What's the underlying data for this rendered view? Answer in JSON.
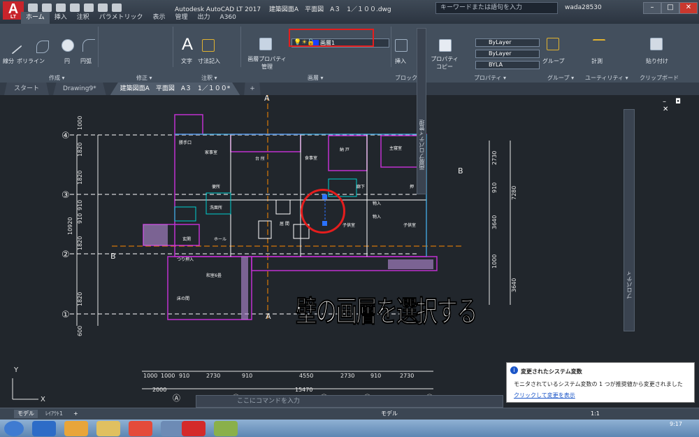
{
  "app": {
    "logo": "A",
    "logo_sub": "LT",
    "title": "Autodesk AutoCAD LT 2017　 建築図面A　平面図　A３　1／１００.dwg",
    "search_placeholder": "キーワードまたは語句を入力",
    "user": "wada28530"
  },
  "ribbon_tabs": [
    "ホーム",
    "挿入",
    "注釈",
    "パラメトリック",
    "表示",
    "管理",
    "出力",
    "A360"
  ],
  "ribbon": {
    "draw_buttons": [
      "線分",
      "ポリライン",
      "円",
      "円弧"
    ],
    "text": "文字",
    "dim": "寸法記入",
    "layer_props": "画層プロパティ管理",
    "layer_current": "画層1",
    "insert": "挿入",
    "props_copy": "プロパティコピー",
    "bylayer1": "ByLayer",
    "bylayer2": "ByLayer",
    "bylayer3": "BYLA",
    "group": "グループ",
    "measure": "計測",
    "paste": "貼り付け",
    "panels": [
      "作成 ▾",
      "修正 ▾",
      "注釈 ▾",
      "画層 ▾",
      "ブロック",
      "プロパティ ▾",
      "グループ ▾",
      "ユーティリティ ▾",
      "クリップボード"
    ]
  },
  "doc_tabs": [
    "スタート",
    "Drawing9*",
    "建築図面A　平面図　A３　1／１００*"
  ],
  "drawing": {
    "grid_rows": [
      "④",
      "③",
      "②",
      "①"
    ],
    "grid_cols": [
      "Ⓐ",
      "Ⓑ",
      "Ⓒ",
      "Ⓓ",
      "Ⓔ"
    ],
    "left_dims": [
      "1000",
      "1820",
      "1820",
      "910",
      "910",
      "1820",
      "1820",
      "600"
    ],
    "left_total": "10920",
    "bottom_dims": [
      "1000",
      "1000",
      "910",
      "2730",
      "910",
      "4550",
      "2730",
      "910",
      "2730"
    ],
    "bottom_sub": "2000",
    "bottom_total": "15470",
    "right_dims": [
      "2730",
      "910",
      "3640",
      "1000",
      "3640"
    ],
    "right_total": "7280",
    "rooms": [
      "勝手口",
      "家事室",
      "台 所",
      "食事室",
      "納 戸",
      "主寝室",
      "便所",
      "洗面所",
      "居 間",
      "廊下",
      "物入",
      "物入",
      "子供室",
      "子供室",
      "玄関",
      "ホール",
      "つり押入",
      "和室6畳",
      "床の間",
      "押"
    ],
    "section_marks": [
      "A",
      "A",
      "B",
      "B"
    ],
    "palette_label": "画層プロパティ管理",
    "props_label": "プロパティ",
    "window_ctrls": "– ◘ ✕"
  },
  "caption": "壁の画層を選択する",
  "command_placeholder": "ここにコマンドを入力",
  "notification": {
    "title": "変更されたシステム変数",
    "body": "モニタされているシステム変数の 1 つが推奨値から変更されました",
    "link": "クリックして変更を表示"
  },
  "status": {
    "model_tab": "モデル",
    "layout_tab": "ﾚｲｱｳﾄ1",
    "add": "+",
    "model_space": "モデル",
    "scale": "1:1"
  },
  "clock": "9:17",
  "colors": {
    "highlight": "#e41d1d",
    "background": "#21262c"
  }
}
